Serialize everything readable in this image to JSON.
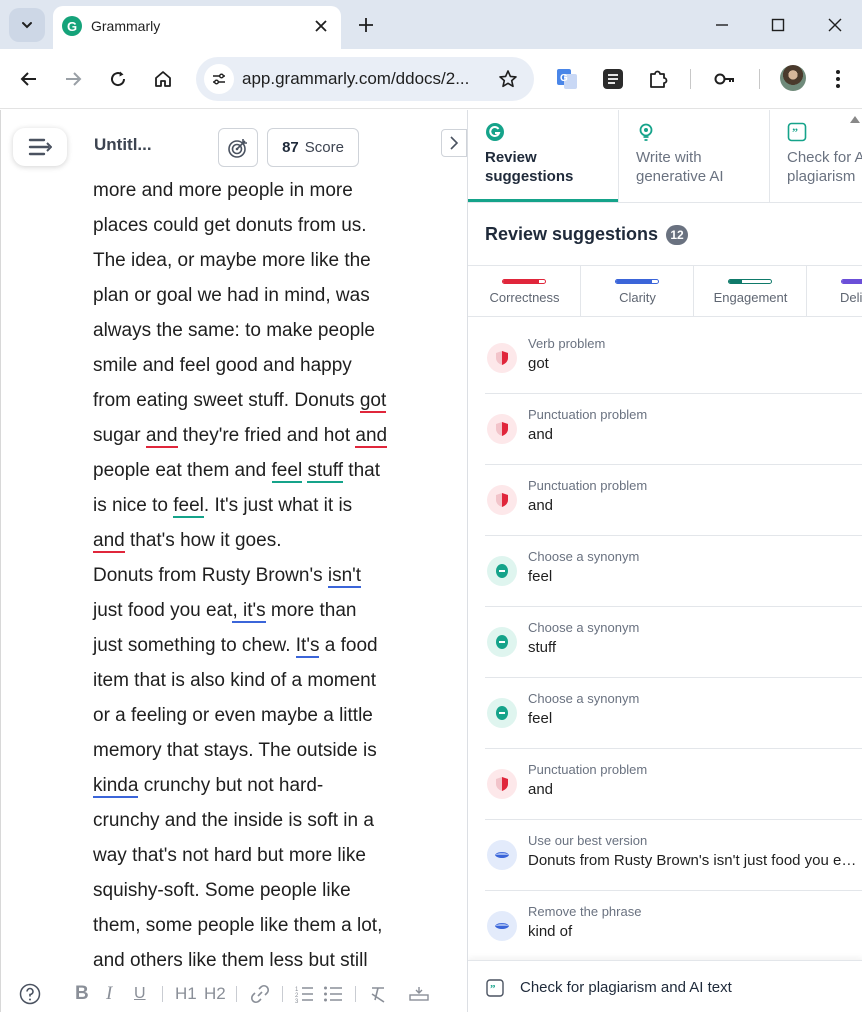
{
  "browser": {
    "tab_title": "Grammarly",
    "url": "app.grammarly.com/ddocs/2..."
  },
  "editor": {
    "doc_title": "Untitl...",
    "score_value": "87",
    "score_label": "Score",
    "lines": [
      [
        {
          "t": "more and more people in more"
        }
      ],
      [
        {
          "t": "places could get donuts from us."
        }
      ],
      [
        {
          "t": "The idea, or maybe more like the"
        }
      ],
      [
        {
          "t": "plan or goal we had in mind, was"
        }
      ],
      [
        {
          "t": "always the same: to make people"
        }
      ],
      [
        {
          "t": "smile and feel good and happy"
        }
      ],
      [
        {
          "t": "from eating sweet stuff. Donuts "
        },
        {
          "t": "got",
          "u": "red"
        }
      ],
      [
        {
          "t": "sugar "
        },
        {
          "t": "and",
          "u": "red"
        },
        {
          "t": " they're fried and hot "
        },
        {
          "t": "and",
          "u": "red"
        }
      ],
      [
        {
          "t": "people eat them and "
        },
        {
          "t": "feel",
          "u": "green"
        },
        {
          "t": " "
        },
        {
          "t": "stuff",
          "u": "green"
        },
        {
          "t": " that"
        }
      ],
      [
        {
          "t": "is nice to "
        },
        {
          "t": "feel",
          "u": "green"
        },
        {
          "t": ". It's just what it is"
        }
      ],
      [
        {
          "t": "and",
          "u": "red"
        },
        {
          "t": " that's how it goes."
        }
      ],
      [
        {
          "t": "Donuts from Rusty Brown's "
        },
        {
          "t": "isn't",
          "u": "blue"
        }
      ],
      [
        {
          "t": "just food you eat"
        },
        {
          "t": ", it's",
          "u": "blue"
        },
        {
          "t": " more than"
        }
      ],
      [
        {
          "t": "just something to chew. "
        },
        {
          "t": "It's",
          "u": "blue"
        },
        {
          "t": " a food"
        }
      ],
      [
        {
          "t": "item that is also kind of a moment"
        }
      ],
      [
        {
          "t": "or a feeling or even maybe a little"
        }
      ],
      [
        {
          "t": "memory that stays. The outside is"
        }
      ],
      [
        {
          "t": "kinda",
          "u": "blue"
        },
        {
          "t": " crunchy but not hard-"
        }
      ],
      [
        {
          "t": "crunchy and the inside is soft in a"
        }
      ],
      [
        {
          "t": "way that's not hard but more like"
        }
      ],
      [
        {
          "t": "squishy-soft. Some people like"
        }
      ],
      [
        {
          "t": "them, some people like them a lot,"
        }
      ],
      [
        {
          "t": "and others like them less but still"
        }
      ]
    ],
    "format_tools": [
      "B",
      "I",
      "U",
      "H1",
      "H2"
    ]
  },
  "panel": {
    "tabs": [
      {
        "label": "Review suggestions",
        "active": true
      },
      {
        "label": "Write with generative AI",
        "active": false
      },
      {
        "label": "Check for AI text & plagiarism",
        "active": false
      }
    ],
    "header": "Review suggestions",
    "count": "12",
    "categories": [
      {
        "label": "Correctness",
        "color": "#e0263b",
        "fill": 0.85
      },
      {
        "label": "Clarity",
        "color": "#3b65d9",
        "fill": 0.85
      },
      {
        "label": "Engagement",
        "color": "#0f7a6a",
        "fill": 0.3
      },
      {
        "label": "Delivery",
        "color": "#6b4fd8",
        "fill": 0.9
      }
    ],
    "suggestions": [
      {
        "type": "Verb problem",
        "text": "got",
        "kind": "correctness"
      },
      {
        "type": "Punctuation problem",
        "text": "and",
        "kind": "correctness"
      },
      {
        "type": "Punctuation problem",
        "text": "and",
        "kind": "correctness"
      },
      {
        "type": "Choose a synonym",
        "text": "feel",
        "kind": "engagement"
      },
      {
        "type": "Choose a synonym",
        "text": "stuff",
        "kind": "engagement"
      },
      {
        "type": "Choose a synonym",
        "text": "feel",
        "kind": "engagement"
      },
      {
        "type": "Punctuation problem",
        "text": "and",
        "kind": "correctness"
      },
      {
        "type": "Use our best version",
        "text": "Donuts from Rusty Brown's isn't just food you eat, it's more than",
        "kind": "clarity"
      },
      {
        "type": "Remove the phrase",
        "text": "kind of",
        "kind": "clarity"
      }
    ],
    "plagiarism_label": "Check for plagiarism and AI text"
  }
}
